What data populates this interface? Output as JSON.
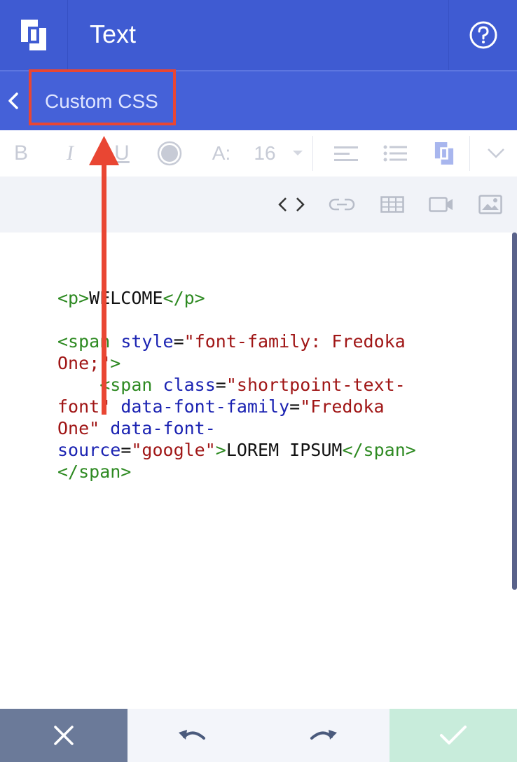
{
  "header": {
    "logo_icon": "shortpoint-logo-icon",
    "title": "Text",
    "help_icon": "help-circle-icon"
  },
  "subheader": {
    "back_icon": "chevron-left-icon",
    "breadcrumb": "Custom CSS"
  },
  "toolbar": {
    "bold": "B",
    "italic": "I",
    "underline": "U",
    "font_size_prefix": "A:",
    "font_size": "16",
    "icons": [
      "bold-icon",
      "italic-icon",
      "underline-icon",
      "color-circle-icon",
      "font-size-icon",
      "dropdown-icon",
      "align-icon",
      "list-icon",
      "shortpoint-logo-icon",
      "expand-chevron-icon"
    ]
  },
  "insert_bar": {
    "icons": [
      "code-view-icon",
      "link-icon",
      "table-icon",
      "video-icon",
      "image-icon"
    ]
  },
  "editor": {
    "code_lines": [
      [
        {
          "t": "<p>",
          "c": "tag"
        },
        {
          "t": "WELCOME",
          "c": "txt"
        },
        {
          "t": "</p>",
          "c": "tag"
        }
      ],
      [],
      [
        {
          "t": "<span",
          "c": "tag"
        },
        {
          "t": " style",
          "c": "attr"
        },
        {
          "t": "=",
          "c": "txt"
        },
        {
          "t": "\"font-family: Fredoka",
          "c": "str"
        }
      ],
      [
        {
          "t": "One;\"",
          "c": "str"
        },
        {
          "t": ">",
          "c": "tag"
        }
      ],
      [
        {
          "t": "    <span",
          "c": "tag"
        },
        {
          "t": " class",
          "c": "attr"
        },
        {
          "t": "=",
          "c": "txt"
        },
        {
          "t": "\"shortpoint-text-",
          "c": "str"
        }
      ],
      [
        {
          "t": "font\"",
          "c": "str"
        },
        {
          "t": " data-font-family",
          "c": "attr"
        },
        {
          "t": "=",
          "c": "txt"
        },
        {
          "t": "\"Fredoka",
          "c": "str"
        }
      ],
      [
        {
          "t": "One\"",
          "c": "str"
        },
        {
          "t": " data-font-",
          "c": "attr"
        }
      ],
      [
        {
          "t": "source",
          "c": "attr"
        },
        {
          "t": "=",
          "c": "txt"
        },
        {
          "t": "\"google\"",
          "c": "str"
        },
        {
          "t": ">",
          "c": "tag"
        },
        {
          "t": "LOREM IPSUM",
          "c": "txt"
        },
        {
          "t": "</span>",
          "c": "tag"
        }
      ],
      [
        {
          "t": "</span>",
          "c": "tag"
        }
      ]
    ]
  },
  "footer": {
    "cancel_icon": "close-icon",
    "undo_icon": "undo-icon",
    "redo_icon": "redo-icon",
    "confirm_icon": "check-icon"
  },
  "annotation": {
    "highlight_color": "#e94633",
    "arrow_color": "#e94633"
  },
  "colors": {
    "header_bg": "#3f5bd2",
    "subheader_bg": "#4561d8",
    "tag": "#2e8a22",
    "attr": "#1b23b2",
    "string": "#a01616",
    "cancel_bg": "#6b7a99",
    "confirm_bg": "#c8ecdb"
  }
}
